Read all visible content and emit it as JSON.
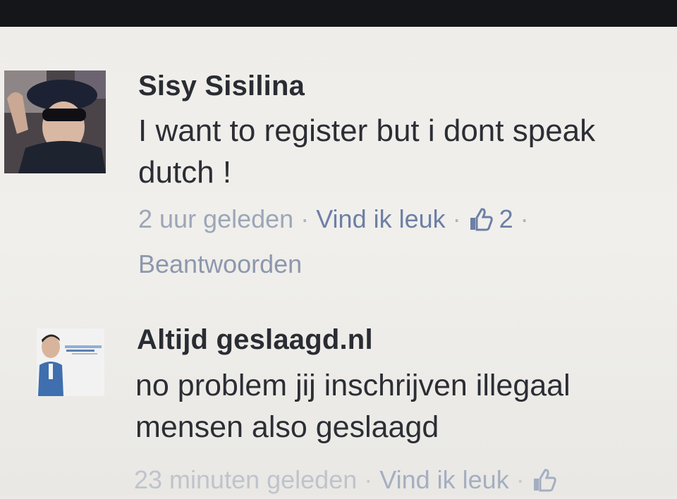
{
  "comments": [
    {
      "author": "Sisy Sisilina",
      "text_lines": [
        "I want to register but i dont speak",
        "dutch !"
      ],
      "time": "2 uur geleden",
      "separator": "·",
      "like_label": "Vind ik leuk",
      "like_count": "2",
      "reply_label": "Beantwoorden",
      "icon": "thumbs-up-icon"
    },
    {
      "author": "Altijd geslaagd.nl",
      "text_lines": [
        "no problem jij inschrijven illegaal",
        "mensen also geslaagd"
      ],
      "time": "23 minuten geleden",
      "separator": "·",
      "like_label": "Vind ik leuk",
      "icon": "thumbs-up-icon"
    }
  ],
  "colors": {
    "link_blue": "#6d7fa6",
    "meta_grey": "#8d97ad",
    "text_dark": "#2c2e35"
  }
}
